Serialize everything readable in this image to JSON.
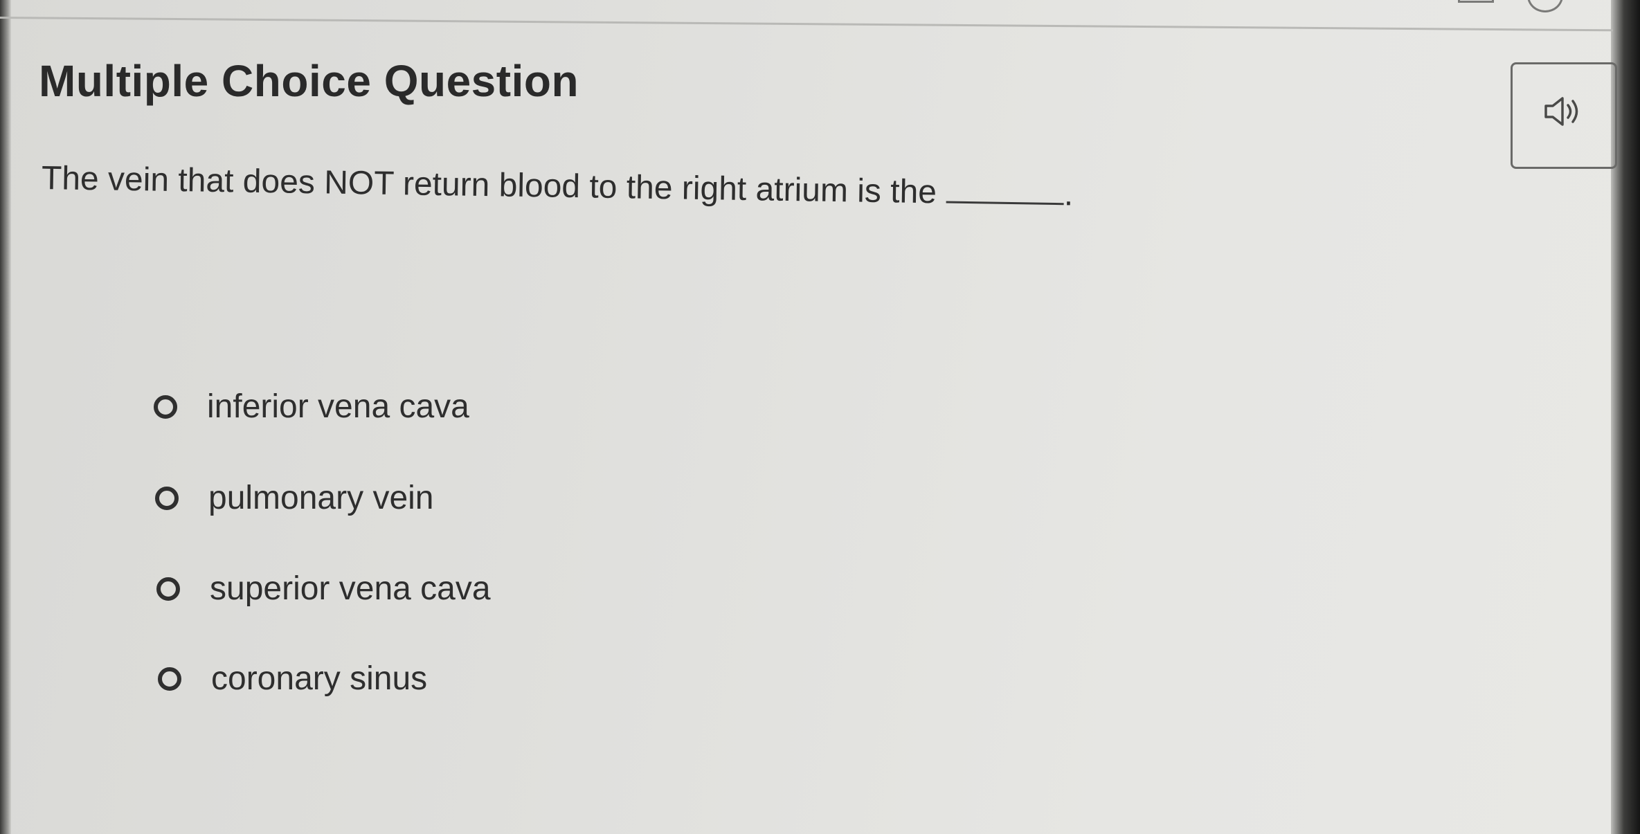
{
  "page": {
    "title": "Multiple Choice Question"
  },
  "question": {
    "text": "The vein that does NOT return blood to the right atrium is the",
    "end_punctuation": "."
  },
  "audio_button": {
    "icon": "speaker-icon"
  },
  "options": [
    {
      "label": "inferior vena cava",
      "selected": false
    },
    {
      "label": "pulmonary vein",
      "selected": false
    },
    {
      "label": "superior vena cava",
      "selected": false
    },
    {
      "label": "coronary sinus",
      "selected": false
    }
  ]
}
